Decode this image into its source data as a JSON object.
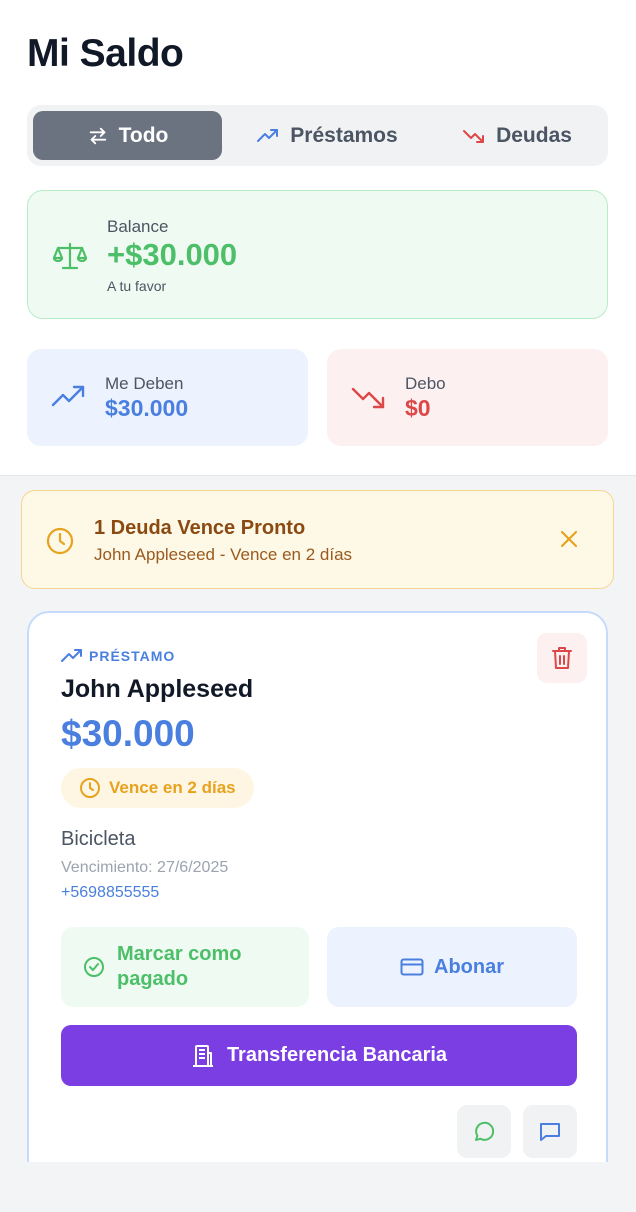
{
  "header": {
    "title": "Mi Saldo"
  },
  "filters": [
    {
      "label": "Todo",
      "icon": "arrows-swap-icon",
      "active": true
    },
    {
      "label": "Préstamos",
      "icon": "trending-up-icon",
      "active": false
    },
    {
      "label": "Deudas",
      "icon": "trending-down-icon",
      "active": false
    }
  ],
  "balance": {
    "label": "Balance",
    "value": "+$30.000",
    "subtitle": "A tu favor",
    "icon": "scale-icon"
  },
  "stats": {
    "owed": {
      "label": "Me Deben",
      "value": "$30.000",
      "icon": "trending-up-icon"
    },
    "debt": {
      "label": "Debo",
      "value": "$0",
      "icon": "trending-down-icon"
    }
  },
  "alert": {
    "title": "1 Deuda Vence Pronto",
    "subtitle": "John Appleseed - Vence en 2 días",
    "icon": "clock-icon"
  },
  "loan": {
    "type_label": "PRÉSTAMO",
    "name": "John Appleseed",
    "amount": "$30.000",
    "due_badge": "Vence en 2 días",
    "concept": "Bicicleta",
    "due_date": "Vencimiento: 27/6/2025",
    "phone": "+5698855555",
    "actions": {
      "mark_paid": "Marcar como pagado",
      "pay": "Abonar",
      "transfer": "Transferencia Bancaria"
    }
  },
  "colors": {
    "green": "#4cbf68",
    "blue": "#4a7fe0",
    "red": "#dc4848",
    "amber": "#e7a21f",
    "purple": "#7a3ee3"
  }
}
